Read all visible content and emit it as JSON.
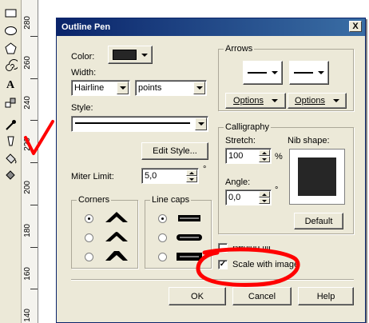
{
  "dialog": {
    "title": "Outline Pen",
    "close_glyph": "X"
  },
  "ruler": {
    "labels": [
      "280",
      "260",
      "240",
      "220",
      "200",
      "180",
      "160",
      "140"
    ]
  },
  "color": {
    "label": "Color:",
    "swatch": "#262626"
  },
  "width": {
    "label": "Width:",
    "value": "Hairline",
    "units": "points"
  },
  "style": {
    "label": "Style:",
    "edit_button": "Edit Style..."
  },
  "miter": {
    "label": "Miter Limit:",
    "value": "5,0",
    "unit": "°"
  },
  "corners": {
    "title": "Corners"
  },
  "line_caps": {
    "title": "Line caps"
  },
  "arrows": {
    "title": "Arrows",
    "options_left": "Options",
    "options_right": "Options"
  },
  "calligraphy": {
    "title": "Calligraphy",
    "stretch_label": "Stretch:",
    "stretch_value": "100",
    "stretch_unit": "%",
    "angle_label": "Angle:",
    "angle_value": "0,0",
    "angle_unit": "°",
    "nib_label": "Nib shape:",
    "nib_color": "#262626",
    "default_button": "Default"
  },
  "behind_fill": {
    "label": "Behind fill"
  },
  "scale_with_image": {
    "label": "Scale with image",
    "checked_glyph": "✓"
  },
  "buttons": {
    "ok": "OK",
    "cancel": "Cancel",
    "help": "Help"
  },
  "annotation_color": "#ff0000"
}
